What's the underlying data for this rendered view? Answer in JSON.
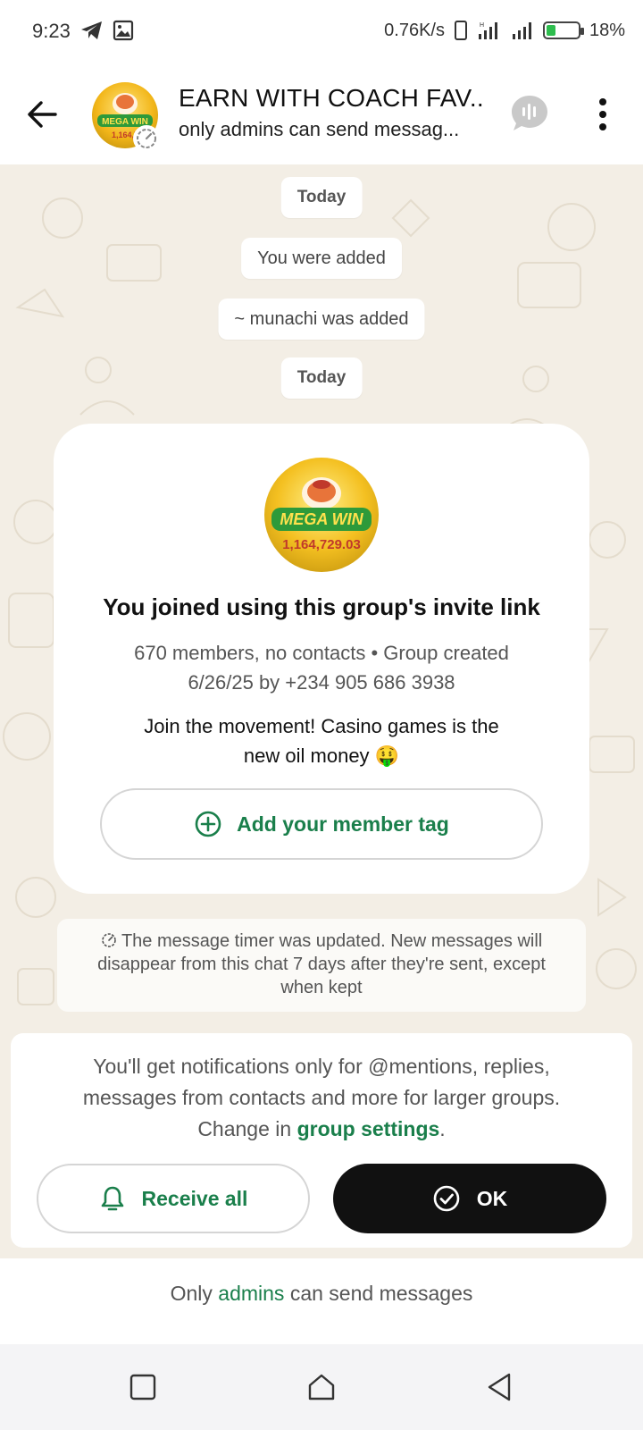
{
  "status_bar": {
    "time": "9:23",
    "network_speed": "0.76K/s",
    "battery_percent": "18%",
    "battery_level": 0.18
  },
  "header": {
    "title": "EARN WITH COACH FAV...",
    "subtitle": "only admins can send messag..."
  },
  "chat": {
    "date_pill_1": "Today",
    "system_added_you": "You were added",
    "system_added_other": "~ munachi was added",
    "date_pill_2": "Today",
    "invite_card": {
      "title": "You joined using this group's invite link",
      "meta_line_1": "670 members, no contacts • Group created",
      "meta_line_2": "6/26/25 by +234 905 686 3938",
      "description_line_1": "Join the movement! Casino games is the",
      "description_line_2": "new oil money 🤑",
      "tag_button_label": "Add your member tag",
      "avatar_text_1": "MEGA WIN",
      "avatar_text_2": "1,164,729.03"
    },
    "timer_note": {
      "line_1": "The message timer was updated. New messages will",
      "line_2": "disappear from this chat 7 days after they're sent, except",
      "line_3": "when kept"
    }
  },
  "notification_panel": {
    "text_line_1": "You'll get notifications only for @mentions, replies,",
    "text_line_2": "messages from contacts and more for larger groups.",
    "text_line_3_prefix": "Change in",
    "text_line_3_link": "group settings",
    "text_line_3_suffix": ".",
    "receive_all_label": "Receive all",
    "ok_label": "OK"
  },
  "footer": {
    "prefix": "Only",
    "link": "admins",
    "suffix": "can send messages"
  },
  "colors": {
    "accent_green": "#1a7f4b",
    "chat_bg": "#f3eee5",
    "ok_button_bg": "#111111"
  },
  "icons": {
    "back": "arrow-left-icon",
    "call": "voice-chat-icon",
    "menu": "more-vertical-icon",
    "timer": "timer-icon",
    "add": "plus-circle-icon",
    "bell": "bell-icon",
    "check": "check-circle-icon"
  }
}
